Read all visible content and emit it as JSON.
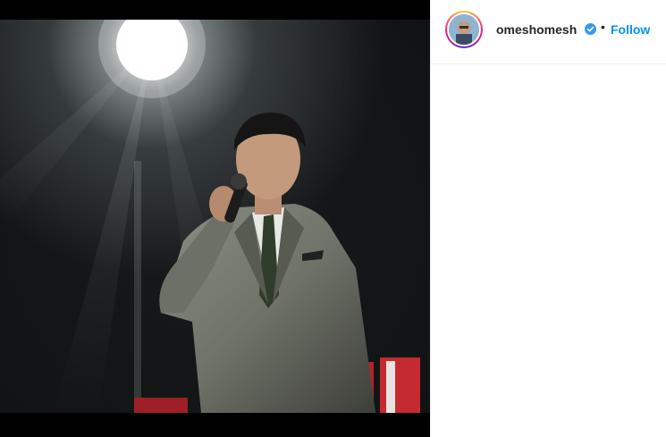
{
  "post": {
    "username": "omeshomesh",
    "verified_icon": "verified-badge-icon",
    "separator": "•",
    "follow_label": "Follow",
    "image_alt": "Performer in a grey suit holding a microphone on a dark stage under a spotlight"
  },
  "colors": {
    "follow": "#0095f6",
    "verified": "#3897f0",
    "username": "#262626"
  }
}
